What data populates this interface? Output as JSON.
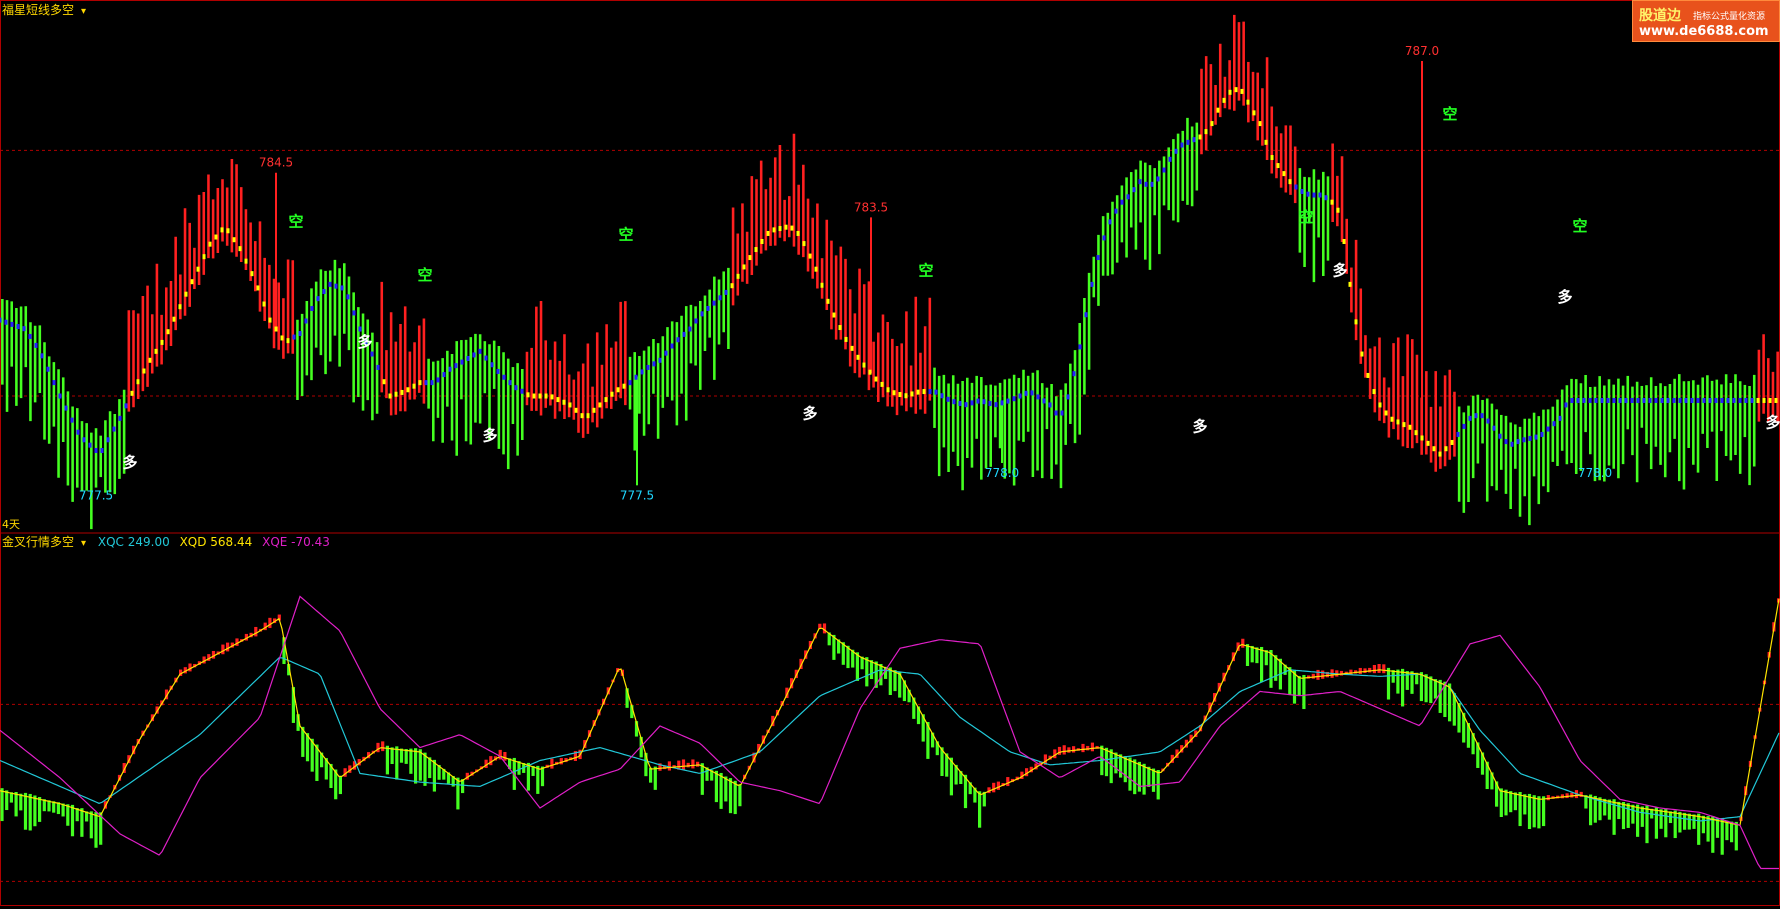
{
  "top_panel": {
    "title": "福星短线多空",
    "price_labels": [
      "784.5",
      "783.5",
      "787.0",
      "777.5",
      "777.5",
      "778.0",
      "778.0"
    ],
    "signal_long": "多",
    "signal_short": "空"
  },
  "period_label": "4天",
  "bottom_panel": {
    "title": "金叉行情多空",
    "xqc": "XQC 249.00",
    "xqd": "XQD 568.44",
    "xqe": "XQE -70.43"
  },
  "logo": {
    "line1": "股道边",
    "line2": "指标公式量化资源",
    "line3": "www.de6688.com"
  },
  "colors": {
    "background": "#000000",
    "up": "#ff2020",
    "down": "#44ff20",
    "frame": "#b00000",
    "mid": "#ffff00",
    "trend_up": "#ffff00",
    "trend_down": "#2222ff",
    "xqc": "#22c8d8",
    "xqd": "#ffe400",
    "xqe": "#e020c8",
    "high_label": "#ff3030",
    "low_label": "#20d8ff"
  },
  "chart_data": [
    {
      "type": "bar",
      "title": "福星短线多空",
      "ylim": [
        776.5,
        788.3
      ],
      "n_bars": 380,
      "grid": "dashed-horizontal",
      "points": [
        [
          0,
          781.2
        ],
        [
          25,
          781.0
        ],
        [
          40,
          780.5
        ],
        [
          60,
          779.5
        ],
        [
          80,
          778.6
        ],
        [
          100,
          778.2
        ],
        [
          120,
          779.0
        ],
        [
          135,
          779.7
        ],
        [
          150,
          780.3
        ],
        [
          165,
          780.8
        ],
        [
          180,
          781.5
        ],
        [
          195,
          782.2
        ],
        [
          210,
          782.9
        ],
        [
          225,
          783.3
        ],
        [
          240,
          782.8
        ],
        [
          255,
          782.1
        ],
        [
          270,
          781.2
        ],
        [
          285,
          780.7
        ],
        [
          300,
          780.9
        ],
        [
          315,
          781.6
        ],
        [
          330,
          782.0
        ],
        [
          345,
          781.9
        ],
        [
          360,
          781.0
        ],
        [
          375,
          780.3
        ],
        [
          390,
          779.5
        ],
        [
          405,
          779.6
        ],
        [
          420,
          779.8
        ],
        [
          435,
          779.8
        ],
        [
          450,
          780.1
        ],
        [
          465,
          780.3
        ],
        [
          480,
          780.5
        ],
        [
          500,
          780.0
        ],
        [
          515,
          779.7
        ],
        [
          530,
          779.5
        ],
        [
          550,
          779.5
        ],
        [
          570,
          779.3
        ],
        [
          585,
          779.0
        ],
        [
          600,
          779.3
        ],
        [
          615,
          779.6
        ],
        [
          630,
          779.8
        ],
        [
          645,
          780.1
        ],
        [
          660,
          780.3
        ],
        [
          675,
          780.7
        ],
        [
          690,
          781.0
        ],
        [
          700,
          781.3
        ],
        [
          715,
          781.6
        ],
        [
          730,
          781.9
        ],
        [
          750,
          782.6
        ],
        [
          770,
          783.2
        ],
        [
          790,
          783.3
        ],
        [
          800,
          783.1
        ],
        [
          815,
          782.4
        ],
        [
          830,
          781.5
        ],
        [
          845,
          780.8
        ],
        [
          860,
          780.3
        ],
        [
          875,
          779.9
        ],
        [
          890,
          779.6
        ],
        [
          905,
          779.5
        ],
        [
          920,
          779.6
        ],
        [
          935,
          779.6
        ],
        [
          950,
          779.4
        ],
        [
          965,
          779.3
        ],
        [
          980,
          779.4
        ],
        [
          995,
          779.3
        ],
        [
          1010,
          779.4
        ],
        [
          1030,
          779.6
        ],
        [
          1050,
          779.3
        ],
        [
          1060,
          779.0
        ],
        [
          1070,
          779.6
        ],
        [
          1080,
          780.6
        ],
        [
          1090,
          781.8
        ],
        [
          1100,
          782.8
        ],
        [
          1110,
          783.4
        ],
        [
          1120,
          783.8
        ],
        [
          1130,
          784.0
        ],
        [
          1140,
          784.3
        ],
        [
          1150,
          784.2
        ],
        [
          1160,
          784.4
        ],
        [
          1170,
          784.8
        ],
        [
          1180,
          785.1
        ],
        [
          1190,
          785.2
        ],
        [
          1200,
          785.3
        ],
        [
          1210,
          785.5
        ],
        [
          1220,
          786.0
        ],
        [
          1230,
          786.3
        ],
        [
          1240,
          786.4
        ],
        [
          1250,
          786.0
        ],
        [
          1260,
          785.6
        ],
        [
          1270,
          784.9
        ],
        [
          1280,
          784.6
        ],
        [
          1290,
          784.3
        ],
        [
          1300,
          784.1
        ],
        [
          1310,
          784.0
        ],
        [
          1320,
          784.0
        ],
        [
          1330,
          783.9
        ],
        [
          1340,
          783.6
        ],
        [
          1350,
          782.0
        ],
        [
          1360,
          780.6
        ],
        [
          1370,
          779.8
        ],
        [
          1380,
          779.3
        ],
        [
          1390,
          779.0
        ],
        [
          1400,
          778.9
        ],
        [
          1410,
          778.8
        ],
        [
          1420,
          778.6
        ],
        [
          1430,
          778.4
        ],
        [
          1440,
          778.2
        ],
        [
          1450,
          778.4
        ],
        [
          1460,
          778.7
        ],
        [
          1470,
          779.0
        ],
        [
          1480,
          779.1
        ],
        [
          1490,
          778.9
        ],
        [
          1500,
          778.6
        ],
        [
          1510,
          778.4
        ],
        [
          1520,
          778.5
        ],
        [
          1540,
          778.6
        ],
        [
          1560,
          779.0
        ],
        [
          1568,
          779.4
        ]
      ],
      "annotations": [
        {
          "i": 276,
          "v": 784.5,
          "text": "784.5",
          "kind": "high"
        },
        {
          "i": 871,
          "v": 783.5,
          "text": "783.5",
          "kind": "high"
        },
        {
          "i": 1422,
          "v": 787.0,
          "text": "787.0",
          "kind": "high"
        },
        {
          "i": 96,
          "v": 777.5,
          "text": "777.5",
          "kind": "low"
        },
        {
          "i": 637,
          "v": 777.5,
          "text": "777.5",
          "kind": "low"
        },
        {
          "i": 1002,
          "v": 778.0,
          "text": "778.0",
          "kind": "low"
        },
        {
          "i": 1595,
          "v": 778.0,
          "text": "778.0",
          "kind": "low"
        }
      ],
      "signals": [
        {
          "i": 130,
          "v": 777.9,
          "text": "多"
        },
        {
          "i": 365,
          "v": 780.6,
          "text": "多"
        },
        {
          "i": 490,
          "v": 778.5,
          "text": "多"
        },
        {
          "i": 810,
          "v": 779.0,
          "text": "多"
        },
        {
          "i": 1200,
          "v": 778.7,
          "text": "多"
        },
        {
          "i": 1340,
          "v": 782.2,
          "text": "多"
        },
        {
          "i": 1565,
          "v": 781.6,
          "text": "多"
        },
        {
          "i": 1773,
          "v": 778.8,
          "text": "多"
        },
        {
          "i": 296,
          "v": 783.3,
          "text": "空"
        },
        {
          "i": 425,
          "v": 782.1,
          "text": "空"
        },
        {
          "i": 626,
          "v": 783.0,
          "text": "空"
        },
        {
          "i": 926,
          "v": 782.2,
          "text": "空"
        },
        {
          "i": 1306,
          "v": 783.4,
          "text": "空"
        },
        {
          "i": 1450,
          "v": 785.7,
          "text": "空"
        },
        {
          "i": 1580,
          "v": 783.2,
          "text": "空"
        }
      ],
      "trend_regime": [
        {
          "from": 0,
          "to": 128,
          "dir": "down"
        },
        {
          "from": 128,
          "to": 293,
          "dir": "up"
        },
        {
          "from": 293,
          "to": 380,
          "dir": "down"
        },
        {
          "from": 380,
          "to": 424,
          "dir": "up"
        },
        {
          "from": 424,
          "to": 525,
          "dir": "down"
        },
        {
          "from": 525,
          "to": 628,
          "dir": "up"
        },
        {
          "from": 628,
          "to": 730,
          "dir": "down"
        },
        {
          "from": 730,
          "to": 930,
          "dir": "up"
        },
        {
          "from": 930,
          "to": 1200,
          "dir": "down"
        },
        {
          "from": 1200,
          "to": 1296,
          "dir": "up"
        },
        {
          "from": 1296,
          "to": 1330,
          "dir": "down"
        },
        {
          "from": 1330,
          "to": 1455,
          "dir": "up"
        },
        {
          "from": 1455,
          "to": 1580,
          "dir": "down"
        },
        {
          "from": 1580,
          "to": 1755,
          "dir": "down"
        },
        {
          "from": 1755,
          "to": 1780,
          "dir": "up"
        }
      ]
    },
    {
      "type": "line",
      "title": "金叉行情多空",
      "ylim": [
        -150,
        700
      ],
      "grid": "dashed-horizontal",
      "series": [
        {
          "name": "XQC",
          "points": [
            [
              0,
              180
            ],
            [
              100,
              80
            ],
            [
              200,
              240
            ],
            [
              280,
              420
            ],
            [
              320,
              380
            ],
            [
              360,
              150
            ],
            [
              420,
              130
            ],
            [
              480,
              120
            ],
            [
              540,
              180
            ],
            [
              600,
              210
            ],
            [
              660,
              170
            ],
            [
              700,
              150
            ],
            [
              760,
              200
            ],
            [
              820,
              330
            ],
            [
              880,
              390
            ],
            [
              920,
              380
            ],
            [
              960,
              280
            ],
            [
              1010,
              200
            ],
            [
              1050,
              170
            ],
            [
              1100,
              180
            ],
            [
              1160,
              200
            ],
            [
              1200,
              260
            ],
            [
              1240,
              340
            ],
            [
              1290,
              390
            ],
            [
              1340,
              380
            ],
            [
              1380,
              375
            ],
            [
              1420,
              380
            ],
            [
              1450,
              350
            ],
            [
              1480,
              250
            ],
            [
              1520,
              150
            ],
            [
              1580,
              100
            ],
            [
              1640,
              60
            ],
            [
              1700,
              40
            ],
            [
              1740,
              50
            ],
            [
              1780,
              249
            ]
          ]
        },
        {
          "name": "XQD",
          "points": [
            [
              0,
              110
            ],
            [
              60,
              80
            ],
            [
              100,
              50
            ],
            [
              140,
              230
            ],
            [
              180,
              380
            ],
            [
              220,
              430
            ],
            [
              260,
              480
            ],
            [
              280,
              510
            ],
            [
              300,
              260
            ],
            [
              340,
              140
            ],
            [
              380,
              210
            ],
            [
              420,
              200
            ],
            [
              460,
              130
            ],
            [
              500,
              190
            ],
            [
              540,
              160
            ],
            [
              580,
              190
            ],
            [
              620,
              400
            ],
            [
              650,
              160
            ],
            [
              700,
              170
            ],
            [
              740,
              120
            ],
            [
              780,
              300
            ],
            [
              820,
              490
            ],
            [
              860,
              420
            ],
            [
              900,
              380
            ],
            [
              940,
              210
            ],
            [
              980,
              100
            ],
            [
              1020,
              140
            ],
            [
              1060,
              200
            ],
            [
              1100,
              210
            ],
            [
              1160,
              150
            ],
            [
              1200,
              250
            ],
            [
              1240,
              450
            ],
            [
              1270,
              430
            ],
            [
              1300,
              370
            ],
            [
              1340,
              380
            ],
            [
              1380,
              390
            ],
            [
              1420,
              380
            ],
            [
              1450,
              350
            ],
            [
              1500,
              110
            ],
            [
              1540,
              90
            ],
            [
              1580,
              100
            ],
            [
              1640,
              70
            ],
            [
              1700,
              50
            ],
            [
              1740,
              30
            ],
            [
              1780,
              568
            ]
          ]
        },
        {
          "name": "XQE",
          "points": [
            [
              0,
              250
            ],
            [
              60,
              140
            ],
            [
              120,
              10
            ],
            [
              160,
              -40
            ],
            [
              200,
              140
            ],
            [
              260,
              280
            ],
            [
              300,
              560
            ],
            [
              340,
              480
            ],
            [
              380,
              300
            ],
            [
              420,
              210
            ],
            [
              460,
              240
            ],
            [
              500,
              190
            ],
            [
              540,
              70
            ],
            [
              580,
              130
            ],
            [
              620,
              160
            ],
            [
              660,
              260
            ],
            [
              700,
              220
            ],
            [
              740,
              130
            ],
            [
              780,
              110
            ],
            [
              820,
              80
            ],
            [
              860,
              300
            ],
            [
              900,
              440
            ],
            [
              940,
              460
            ],
            [
              980,
              450
            ],
            [
              1020,
              200
            ],
            [
              1060,
              140
            ],
            [
              1100,
              190
            ],
            [
              1140,
              120
            ],
            [
              1180,
              130
            ],
            [
              1220,
              260
            ],
            [
              1260,
              340
            ],
            [
              1300,
              330
            ],
            [
              1340,
              340
            ],
            [
              1380,
              300
            ],
            [
              1420,
              260
            ],
            [
              1470,
              450
            ],
            [
              1500,
              470
            ],
            [
              1540,
              350
            ],
            [
              1580,
              180
            ],
            [
              1620,
              90
            ],
            [
              1660,
              70
            ],
            [
              1700,
              60
            ],
            [
              1740,
              30
            ],
            [
              1760,
              -70
            ]
          ]
        }
      ],
      "legend_values": {
        "XQC": 249.0,
        "XQD": 568.44,
        "XQE": -70.43
      }
    }
  ]
}
